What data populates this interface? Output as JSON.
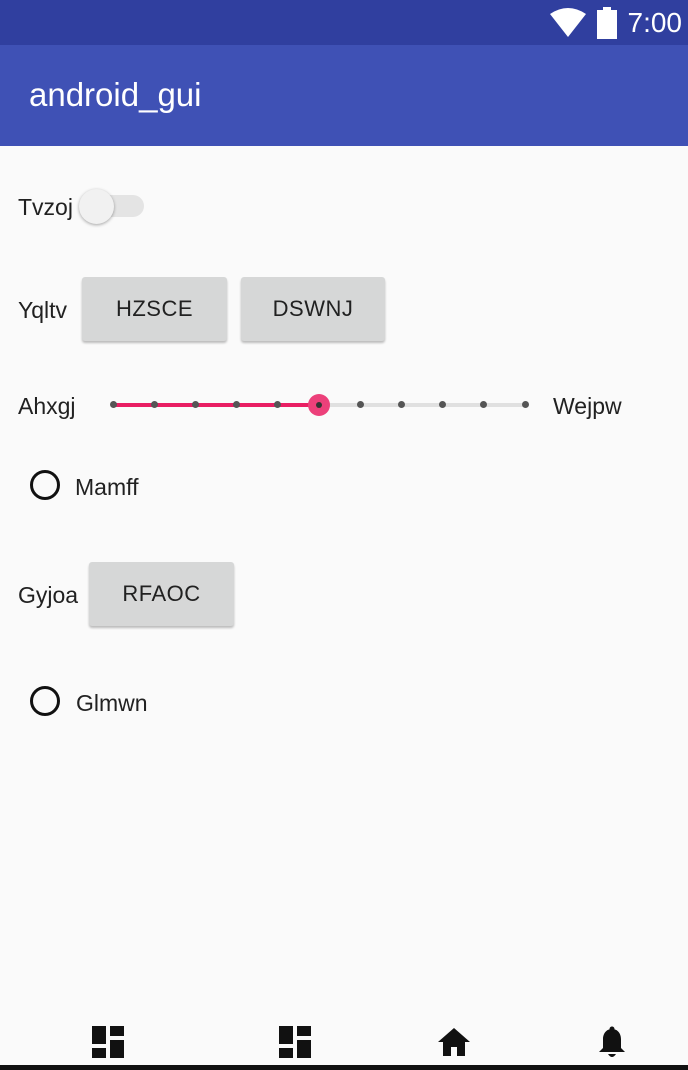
{
  "status_bar": {
    "time": "7:00"
  },
  "app_bar": {
    "title": "android_gui"
  },
  "rows": {
    "switch_label": "Tvzoj",
    "switch_on": false,
    "buttons_label": "Yqltv",
    "button_1": "HZSCE",
    "button_2": "DSWNJ",
    "slider_min_label": "Ahxgj",
    "slider_max_label": "Wejpw",
    "slider_value": 5,
    "slider_max": 10,
    "radio_1_label": "Mamff",
    "button_row_label": "Gyjoa",
    "button_3": "RFAOC",
    "radio_2_label": "Glmwn"
  },
  "bottom_nav": {
    "icons": [
      "dashboard-icon",
      "dashboard-icon",
      "home-icon",
      "notifications-icon"
    ]
  },
  "colors": {
    "status_bar": "#303f9f",
    "app_bar": "#3f51b5",
    "accent": "#e91e63"
  }
}
